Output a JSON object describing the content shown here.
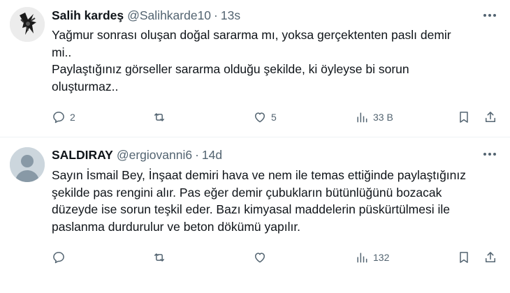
{
  "tweets": [
    {
      "display_name": "Salih kardeş",
      "handle": "@Salihkarde10",
      "separator": "·",
      "time": "13s",
      "lines": [
        "Yağmur sonrası oluşan doğal sararma mı, yoksa gerçektenten paslı demir",
        "mi..",
        "Paylaştığınız görseller sararma olduğu şekilde, ki öyleyse bi sorun",
        "oluşturmaz.."
      ],
      "reply_count": "2",
      "retweet_count": "",
      "like_count": "5",
      "view_count": "33 B",
      "icons": {
        "reply": "reply-icon",
        "retweet": "retweet-icon",
        "like": "heart-icon",
        "views": "views-icon",
        "bookmark": "bookmark-icon",
        "share": "share-icon"
      }
    },
    {
      "display_name": "SALDIRAY",
      "handle": "@ergiovanni6",
      "separator": "·",
      "time": "14d",
      "lines": [
        "Sayın İsmail Bey, İnşaat demiri hava ve nem ile temas ettiğinde paylaştığınız",
        "şekilde pas rengini alır. Pas eğer demir çubukların bütünlüğünü bozacak",
        "düzeyde ise sorun teşkil eder. Bazı kimyasal maddelerin püskürtülmesi ile",
        "paslanma durdurulur ve beton dökümü yapılır."
      ],
      "reply_count": "",
      "retweet_count": "",
      "like_count": "",
      "view_count": "132"
    }
  ],
  "colors": {
    "text": "#0f1419",
    "secondary": "#536471",
    "divider": "#eff3f4",
    "background": "#ffffff"
  }
}
